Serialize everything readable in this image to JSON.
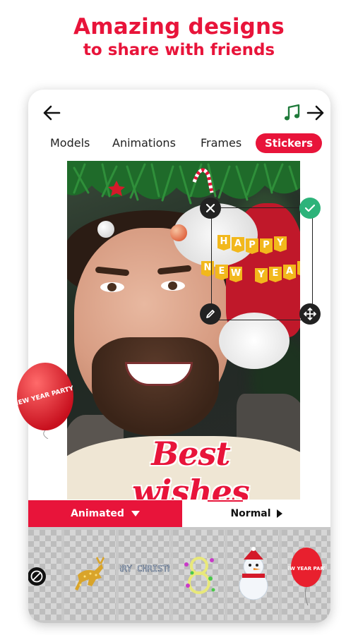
{
  "promo": {
    "headline_line1": "Amazing designs",
    "headline_line2": "to share with friends"
  },
  "tabs": [
    {
      "label": "Models",
      "active": false
    },
    {
      "label": "Animations",
      "active": false
    },
    {
      "label": "Frames",
      "active": false
    },
    {
      "label": "Stickers",
      "active": true
    }
  ],
  "canvas": {
    "overlay_text": "Best wishes",
    "selected_sticker": {
      "line1": [
        "H",
        "A",
        "P",
        "P",
        "Y"
      ],
      "line2": [
        "N",
        "E",
        "W",
        "Y",
        "E",
        "A",
        "R"
      ]
    }
  },
  "floating_sticker": {
    "text": "NEW YEAR PARTY"
  },
  "sticker_mode": {
    "animated_label": "Animated",
    "normal_label": "Normal",
    "selected": "Animated"
  },
  "sticker_tray": [
    {
      "icon": "no-sticker-icon"
    },
    {
      "icon": "reindeer-sticker"
    },
    {
      "icon": "merry-christmas-sticker",
      "text": "MERRY CHRISTMAS"
    },
    {
      "icon": "number-eight-sticker"
    },
    {
      "icon": "snowman-sticker"
    },
    {
      "icon": "new-year-balloon-sticker",
      "text": "NEW YEAR PARTY"
    }
  ],
  "colors": {
    "accent": "#e8143a",
    "confirm": "#2db37a",
    "icon_music": "#1f7a3a"
  }
}
